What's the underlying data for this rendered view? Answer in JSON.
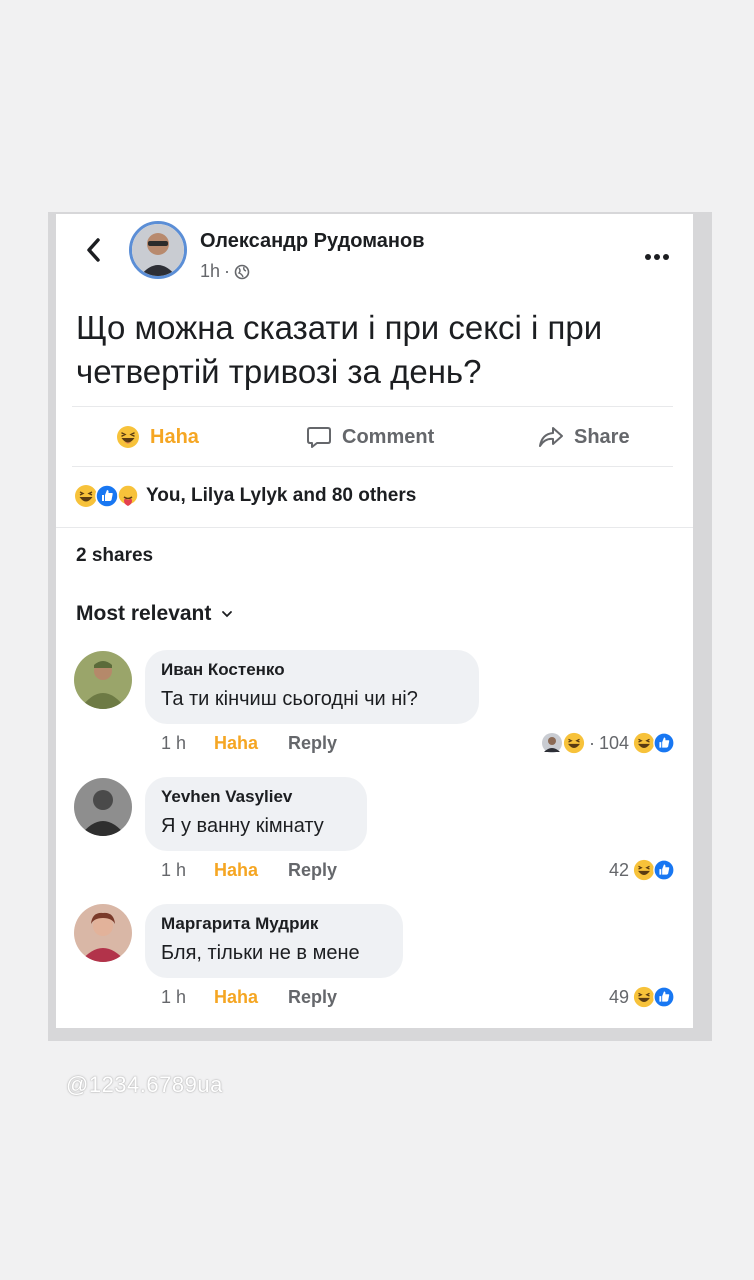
{
  "post": {
    "author": "Олександр Рудоманов",
    "time": "1h",
    "separator": "·",
    "text": "Що можна сказати і при сексі і при четвертій тривозі за день?"
  },
  "actions": {
    "haha": "Haha",
    "comment": "Comment",
    "share": "Share"
  },
  "reactions": {
    "summary": "You, Lilya Lylyk and 80 others"
  },
  "shares": "2 shares",
  "sort": {
    "label": "Most relevant"
  },
  "comments": [
    {
      "name": "Иван Костенко",
      "text": "Та ти кінчиш сьогодні чи ні?",
      "time": "1 h",
      "haha": "Haha",
      "reply": "Reply",
      "count": "104",
      "count_prefix": "·"
    },
    {
      "name": "Yevhen Vasyliev",
      "text": "Я у ванну кімнату",
      "time": "1 h",
      "haha": "Haha",
      "reply": "Reply",
      "count": "42"
    },
    {
      "name": "Маргарита Мудрик",
      "text": "Бля, тільки не в мене",
      "time": "1 h",
      "haha": "Haha",
      "reply": "Reply",
      "count": "49"
    }
  ],
  "watermark": "@1234.6789ua",
  "colors": {
    "haha_orange": "#f5a623",
    "like_blue": "#1877f2",
    "text_primary": "#1c1e21",
    "text_secondary": "#65676b",
    "bubble_bg": "#eff1f4"
  }
}
